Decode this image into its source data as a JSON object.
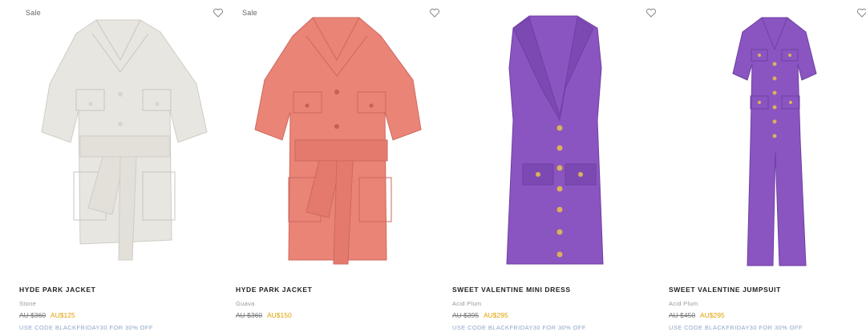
{
  "products": [
    {
      "sale_badge": "Sale",
      "name": "HYDE PARK JACKET",
      "colour": "Stone",
      "old_price": "AU $360",
      "new_price": "AU$125",
      "promo": "USE CODE BLACKFRIDAY30 FOR 30% OFF",
      "garment_color": "#e8e6e1",
      "garment_icon": "jacket-image"
    },
    {
      "sale_badge": "Sale",
      "name": "HYDE PARK JACKET",
      "colour": "Guava",
      "old_price": "AU $360",
      "new_price": "AU$150",
      "promo": "",
      "garment_color": "#e98477",
      "garment_icon": "jacket-image"
    },
    {
      "sale_badge": "",
      "name": "SWEET VALENTINE MINI DRESS",
      "colour": "Acid Plum",
      "old_price": "AU $395",
      "new_price": "AU$295",
      "promo": "USE CODE BLACKFRIDAY30 FOR 30% OFF",
      "garment_color": "#8a55c0",
      "garment_icon": "dress-image"
    },
    {
      "sale_badge": "",
      "name": "SWEET VALENTINE JUMPSUIT",
      "colour": "Acid Plum",
      "old_price": "AU $450",
      "new_price": "AU$295",
      "promo": "USE CODE BLACKFRIDAY30 FOR 30% OFF",
      "garment_color": "#8a55c0",
      "garment_icon": "jumpsuit-image"
    }
  ],
  "colors": {
    "sale_price": "#e0a000",
    "promo_text": "#8fa6c9",
    "muted_text": "#999999"
  }
}
